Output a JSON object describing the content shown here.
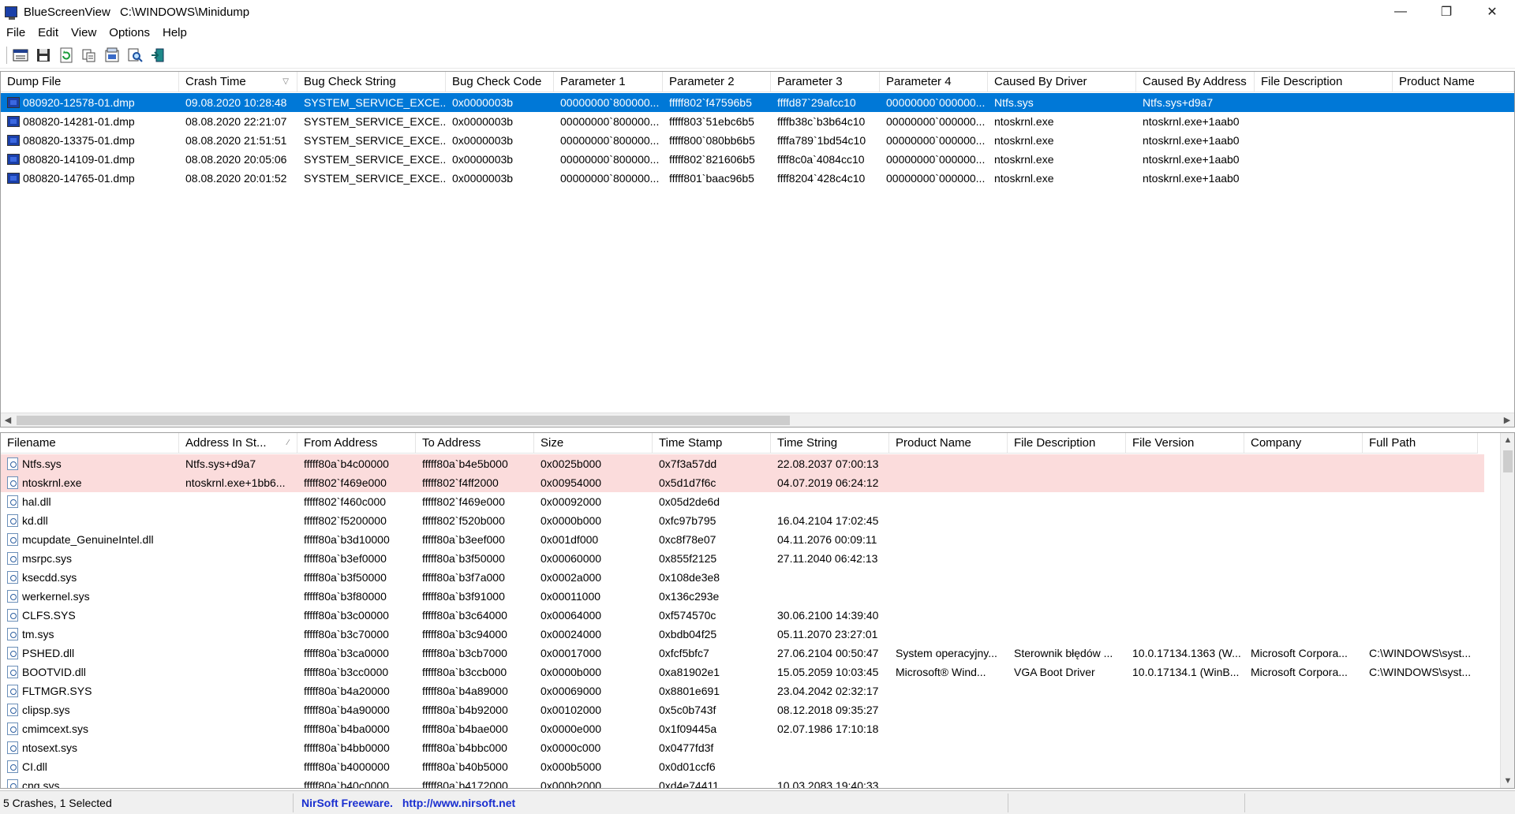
{
  "window": {
    "app_name": "BlueScreenView",
    "path": "C:\\WINDOWS\\Minidump",
    "minimize": "—",
    "maximize": "❐",
    "close": "✕"
  },
  "menu": [
    "File",
    "Edit",
    "View",
    "Options",
    "Help"
  ],
  "toolbar": {
    "buttons": [
      "properties-icon",
      "save-icon",
      "refresh-icon",
      "copy-icon",
      "html-report-icon",
      "find-icon",
      "exit-icon"
    ]
  },
  "crashes": {
    "columns": [
      "Dump File",
      "Crash Time",
      "Bug Check String",
      "Bug Check Code",
      "Parameter 1",
      "Parameter 2",
      "Parameter 3",
      "Parameter 4",
      "Caused By Driver",
      "Caused By Address",
      "File Description",
      "Product Name"
    ],
    "sort_indicator": "▽",
    "rows": [
      [
        "080920-12578-01.dmp",
        "09.08.2020 10:28:48",
        "SYSTEM_SERVICE_EXCE...",
        "0x0000003b",
        "00000000`800000...",
        "fffff802`f47596b5",
        "ffffd87`29afcc10",
        "00000000`000000...",
        "Ntfs.sys",
        "Ntfs.sys+d9a7",
        "",
        ""
      ],
      [
        "080820-14281-01.dmp",
        "08.08.2020 22:21:07",
        "SYSTEM_SERVICE_EXCE...",
        "0x0000003b",
        "00000000`800000...",
        "fffff803`51ebc6b5",
        "ffffb38c`b3b64c10",
        "00000000`000000...",
        "ntoskrnl.exe",
        "ntoskrnl.exe+1aab0",
        "",
        ""
      ],
      [
        "080820-13375-01.dmp",
        "08.08.2020 21:51:51",
        "SYSTEM_SERVICE_EXCE...",
        "0x0000003b",
        "00000000`800000...",
        "fffff800`080bb6b5",
        "ffffa789`1bd54c10",
        "00000000`000000...",
        "ntoskrnl.exe",
        "ntoskrnl.exe+1aab0",
        "",
        ""
      ],
      [
        "080820-14109-01.dmp",
        "08.08.2020 20:05:06",
        "SYSTEM_SERVICE_EXCE...",
        "0x0000003b",
        "00000000`800000...",
        "fffff802`821606b5",
        "ffff8c0a`4084cc10",
        "00000000`000000...",
        "ntoskrnl.exe",
        "ntoskrnl.exe+1aab0",
        "",
        ""
      ],
      [
        "080820-14765-01.dmp",
        "08.08.2020 20:01:52",
        "SYSTEM_SERVICE_EXCE...",
        "0x0000003b",
        "00000000`800000...",
        "fffff801`baac96b5",
        "ffff8204`428c4c10",
        "00000000`000000...",
        "ntoskrnl.exe",
        "ntoskrnl.exe+1aab0",
        "",
        ""
      ]
    ],
    "selected_index": 0
  },
  "drivers": {
    "columns": [
      "Filename",
      "Address In St...",
      "From Address",
      "To Address",
      "Size",
      "Time Stamp",
      "Time String",
      "Product Name",
      "File Description",
      "File Version",
      "Company",
      "Full Path"
    ],
    "sort_indicator": "∕",
    "rows": [
      [
        "Ntfs.sys",
        "Ntfs.sys+d9a7",
        "fffff80a`b4c00000",
        "fffff80a`b4e5b000",
        "0x0025b000",
        "0x7f3a57dd",
        "22.08.2037 07:00:13",
        "",
        "",
        "",
        "",
        ""
      ],
      [
        "ntoskrnl.exe",
        "ntoskrnl.exe+1bb6...",
        "fffff802`f469e000",
        "fffff802`f4ff2000",
        "0x00954000",
        "0x5d1d7f6c",
        "04.07.2019 06:24:12",
        "",
        "",
        "",
        "",
        ""
      ],
      [
        "hal.dll",
        "",
        "fffff802`f460c000",
        "fffff802`f469e000",
        "0x00092000",
        "0x05d2de6d",
        "",
        "",
        "",
        "",
        "",
        ""
      ],
      [
        "kd.dll",
        "",
        "fffff802`f5200000",
        "fffff802`f520b000",
        "0x0000b000",
        "0xfc97b795",
        "16.04.2104 17:02:45",
        "",
        "",
        "",
        "",
        ""
      ],
      [
        "mcupdate_GenuineIntel.dll",
        "",
        "fffff80a`b3d10000",
        "fffff80a`b3eef000",
        "0x001df000",
        "0xc8f78e07",
        "04.11.2076 00:09:11",
        "",
        "",
        "",
        "",
        ""
      ],
      [
        "msrpc.sys",
        "",
        "fffff80a`b3ef0000",
        "fffff80a`b3f50000",
        "0x00060000",
        "0x855f2125",
        "27.11.2040 06:42:13",
        "",
        "",
        "",
        "",
        ""
      ],
      [
        "ksecdd.sys",
        "",
        "fffff80a`b3f50000",
        "fffff80a`b3f7a000",
        "0x0002a000",
        "0x108de3e8",
        "",
        "",
        "",
        "",
        "",
        ""
      ],
      [
        "werkernel.sys",
        "",
        "fffff80a`b3f80000",
        "fffff80a`b3f91000",
        "0x00011000",
        "0x136c293e",
        "",
        "",
        "",
        "",
        "",
        ""
      ],
      [
        "CLFS.SYS",
        "",
        "fffff80a`b3c00000",
        "fffff80a`b3c64000",
        "0x00064000",
        "0xf574570c",
        "30.06.2100 14:39:40",
        "",
        "",
        "",
        "",
        ""
      ],
      [
        "tm.sys",
        "",
        "fffff80a`b3c70000",
        "fffff80a`b3c94000",
        "0x00024000",
        "0xbdb04f25",
        "05.11.2070 23:27:01",
        "",
        "",
        "",
        "",
        ""
      ],
      [
        "PSHED.dll",
        "",
        "fffff80a`b3ca0000",
        "fffff80a`b3cb7000",
        "0x00017000",
        "0xfcf5bfc7",
        "27.06.2104 00:50:47",
        "System operacyjny...",
        "Sterownik błędów ...",
        "10.0.17134.1363 (W...",
        "Microsoft Corpora...",
        "C:\\WINDOWS\\syst..."
      ],
      [
        "BOOTVID.dll",
        "",
        "fffff80a`b3cc0000",
        "fffff80a`b3ccb000",
        "0x0000b000",
        "0xa81902e1",
        "15.05.2059 10:03:45",
        "Microsoft® Wind...",
        "VGA Boot Driver",
        "10.0.17134.1 (WinB...",
        "Microsoft Corpora...",
        "C:\\WINDOWS\\syst..."
      ],
      [
        "FLTMGR.SYS",
        "",
        "fffff80a`b4a20000",
        "fffff80a`b4a89000",
        "0x00069000",
        "0x8801e691",
        "23.04.2042 02:32:17",
        "",
        "",
        "",
        "",
        ""
      ],
      [
        "clipsp.sys",
        "",
        "fffff80a`b4a90000",
        "fffff80a`b4b92000",
        "0x00102000",
        "0x5c0b743f",
        "08.12.2018 09:35:27",
        "",
        "",
        "",
        "",
        ""
      ],
      [
        "cmimcext.sys",
        "",
        "fffff80a`b4ba0000",
        "fffff80a`b4bae000",
        "0x0000e000",
        "0x1f09445a",
        "02.07.1986 17:10:18",
        "",
        "",
        "",
        "",
        ""
      ],
      [
        "ntosext.sys",
        "",
        "fffff80a`b4bb0000",
        "fffff80a`b4bbc000",
        "0x0000c000",
        "0x0477fd3f",
        "",
        "",
        "",
        "",
        "",
        ""
      ],
      [
        "CI.dll",
        "",
        "fffff80a`b4000000",
        "fffff80a`b40b5000",
        "0x000b5000",
        "0x0d01ccf6",
        "",
        "",
        "",
        "",
        "",
        ""
      ],
      [
        "cng.sys",
        "",
        "fffff80a`b40c0000",
        "fffff80a`b4172000",
        "0x000b2000",
        "0xd4e74411",
        "10.03.2083 19:40:33",
        "",
        "",
        "",
        "",
        ""
      ]
    ],
    "highlighted_rows": [
      0,
      1
    ]
  },
  "status": {
    "count_text": "5 Crashes, 1 Selected",
    "nirsoft_label": "NirSoft Freeware.",
    "nirsoft_url": "http://www.nirsoft.net"
  },
  "colors": {
    "selection": "#0078d7",
    "highlight_row": "#fbdcdc",
    "link": "#1a2fd0"
  }
}
